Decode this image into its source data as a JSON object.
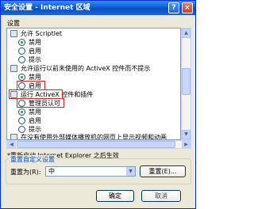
{
  "window": {
    "title": "安全设置 - Internet 区域",
    "help_label": "?",
    "close_label": "×"
  },
  "settings_label": "设置",
  "tree": [
    {
      "kind": "group",
      "icon": "settings-icon",
      "text": "允许 Scriptlet"
    },
    {
      "kind": "radio",
      "text": "禁用",
      "checked": true
    },
    {
      "kind": "radio",
      "text": "启用",
      "checked": false
    },
    {
      "kind": "radio",
      "text": "提示",
      "checked": false
    },
    {
      "kind": "group",
      "icon": "settings-icon",
      "text": "允许运行以前未使用的 ActiveX 控件而不提示"
    },
    {
      "kind": "radio",
      "text": "禁用",
      "checked": true
    },
    {
      "kind": "radio",
      "text": "启用",
      "checked": false
    },
    {
      "kind": "group",
      "icon": "settings-icon",
      "text": "运行 ActiveX 控件和插件"
    },
    {
      "kind": "radio",
      "text": "管理员认可",
      "checked": false
    },
    {
      "kind": "radio",
      "text": "禁用",
      "checked": true
    },
    {
      "kind": "radio",
      "text": "启用",
      "checked": false
    },
    {
      "kind": "radio",
      "text": "提示",
      "checked": false
    },
    {
      "kind": "group",
      "icon": "settings-icon",
      "text": "在没有使用外部媒体播放机的网页上显示视频和动画"
    }
  ],
  "restart_note": "*重新启动 Internet Explorer 之后生效",
  "reset_group": {
    "title": "重置自定义设置",
    "reset_to_label": "重置为(R):",
    "selected_value": "中",
    "reset_button": "重置(E)..."
  },
  "buttons": {
    "ok": "确定",
    "cancel": "取消"
  },
  "colors": {
    "titlebar": "#0b5fd8",
    "dialog_bg": "#ece9d8",
    "highlight_box": "#d62828",
    "radio_dot": "#21a121"
  }
}
